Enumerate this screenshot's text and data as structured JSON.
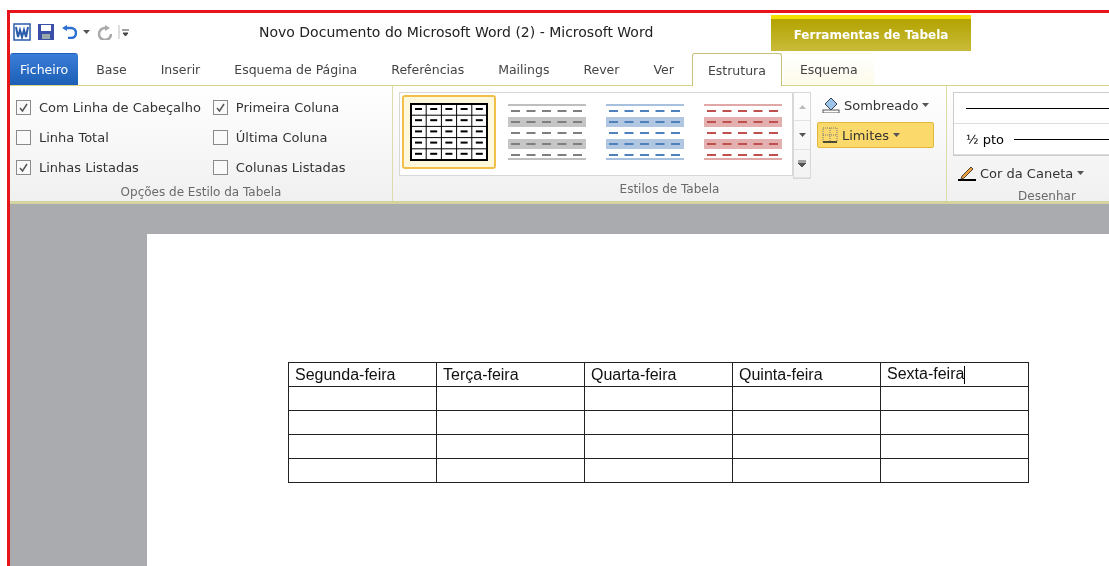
{
  "window": {
    "title": "Novo Documento do Microsoft Word (2)  -  Microsoft Word",
    "context_tab": "Ferramentas de Tabela"
  },
  "tabs": [
    {
      "label": "Ficheiro",
      "kind": "file",
      "selected": false
    },
    {
      "label": "Base",
      "kind": "tab",
      "selected": false
    },
    {
      "label": "Inserir",
      "kind": "tab",
      "selected": false
    },
    {
      "label": "Esquema de Página",
      "kind": "tab",
      "selected": false
    },
    {
      "label": "Referências",
      "kind": "tab",
      "selected": false
    },
    {
      "label": "Mailings",
      "kind": "tab",
      "selected": false
    },
    {
      "label": "Rever",
      "kind": "tab",
      "selected": false
    },
    {
      "label": "Ver",
      "kind": "tab",
      "selected": false
    },
    {
      "label": "Estrutura",
      "kind": "context",
      "selected": true
    },
    {
      "label": "Esquema",
      "kind": "context",
      "selected": false
    }
  ],
  "style_options": {
    "label": "Opções de Estilo da Tabela",
    "checkboxes": [
      {
        "label": "Com Linha de Cabeçalho",
        "checked": true
      },
      {
        "label": "Linha Total",
        "checked": false
      },
      {
        "label": "Linhas Listadas",
        "checked": true
      },
      {
        "label": "Primeira Coluna",
        "checked": true
      },
      {
        "label": "Última Coluna",
        "checked": false
      },
      {
        "label": "Colunas Listadas",
        "checked": false
      }
    ]
  },
  "table_styles": {
    "label": "Estilos de Tabela",
    "styles": [
      {
        "kind": "grid",
        "color": "#000000",
        "selected": true
      },
      {
        "kind": "banded",
        "color": "#7f7f7f",
        "selected": false
      },
      {
        "kind": "banded",
        "color": "#4f81bd",
        "selected": false
      },
      {
        "kind": "banded",
        "color": "#c0504d",
        "selected": false
      }
    ],
    "shading": "Sombreado",
    "borders": {
      "label": "Limites",
      "active": true
    }
  },
  "draw": {
    "label": "Desenhar",
    "weight": "½ pto",
    "pen_color": "Cor da Caneta"
  },
  "table": {
    "columns": [
      "Segunda-feira",
      "Terça-feira",
      "Quarta-feira",
      "Quinta-feira",
      "Sexta-feira"
    ]
  }
}
